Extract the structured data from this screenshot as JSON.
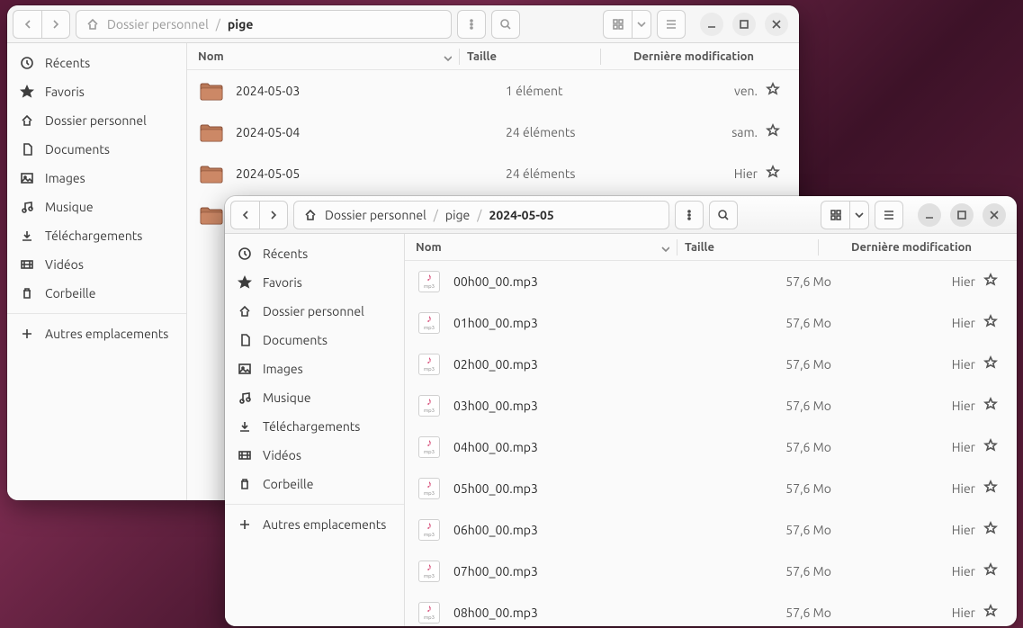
{
  "sidebar": {
    "recents": "Récents",
    "favorites": "Favoris",
    "home": "Dossier personnel",
    "documents": "Documents",
    "images": "Images",
    "music": "Musique",
    "downloads": "Téléchargements",
    "videos": "Vidéos",
    "trash": "Corbeille",
    "other": "Autres emplacements"
  },
  "columns": {
    "name": "Nom",
    "size": "Taille",
    "modified": "Dernière modification"
  },
  "win1": {
    "path": {
      "seg1": "Dossier personnel",
      "seg2": "pige"
    },
    "rows": [
      {
        "name": "2024-05-03",
        "size": "1 élément",
        "date": "ven."
      },
      {
        "name": "2024-05-04",
        "size": "24 éléments",
        "date": "sam."
      },
      {
        "name": "2024-05-05",
        "size": "24 éléments",
        "date": "Hier"
      }
    ]
  },
  "win2": {
    "path": {
      "seg1": "Dossier personnel",
      "seg2": "pige",
      "seg3": "2024-05-05"
    },
    "rows": [
      {
        "name": "00h00_00.mp3",
        "size": "57,6 Mo",
        "date": "Hier"
      },
      {
        "name": "01h00_00.mp3",
        "size": "57,6 Mo",
        "date": "Hier"
      },
      {
        "name": "02h00_00.mp3",
        "size": "57,6 Mo",
        "date": "Hier"
      },
      {
        "name": "03h00_00.mp3",
        "size": "57,6 Mo",
        "date": "Hier"
      },
      {
        "name": "04h00_00.mp3",
        "size": "57,6 Mo",
        "date": "Hier"
      },
      {
        "name": "05h00_00.mp3",
        "size": "57,6 Mo",
        "date": "Hier"
      },
      {
        "name": "06h00_00.mp3",
        "size": "57,6 Mo",
        "date": "Hier"
      },
      {
        "name": "07h00_00.mp3",
        "size": "57,6 Mo",
        "date": "Hier"
      },
      {
        "name": "08h00_00.mp3",
        "size": "57,6 Mo",
        "date": "Hier"
      }
    ]
  }
}
